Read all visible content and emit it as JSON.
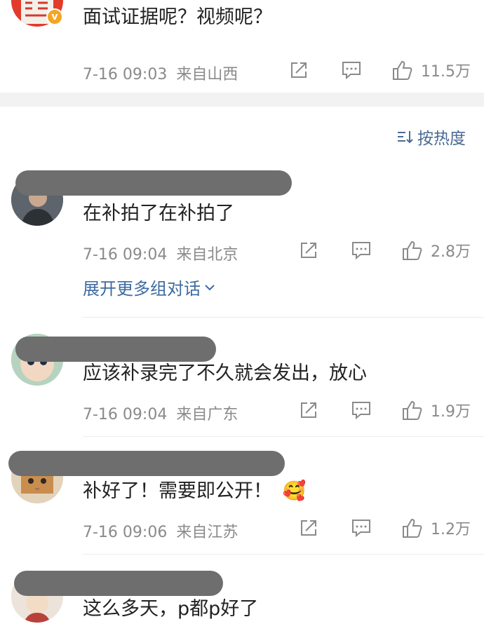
{
  "top_comment": {
    "text": "面试证据呢？视频呢？",
    "time": "7-16 09:03",
    "location": "来自山西",
    "likes": "11.5万",
    "avatar_icon": "seal-avatar-icon",
    "badge": "v"
  },
  "sort": {
    "label": "按热度",
    "icon": "sort-icon"
  },
  "expand_label": "展开更多组对话",
  "comments": [
    {
      "text": "在补拍了在补拍了",
      "time": "7-16 09:04",
      "location": "来自北京",
      "likes": "2.8万"
    },
    {
      "text": "应该补录完了不久就会发出，放心",
      "time": "7-16 09:04",
      "location": "来自广东",
      "likes": "1.9万"
    },
    {
      "text": "补好了！需要即公开！",
      "emoji": "🥰",
      "time": "7-16 09:06",
      "location": "来自江苏",
      "likes": "1.2万"
    },
    {
      "text": "这么多天，p都p好了"
    }
  ],
  "colors": {
    "accent": "#3e6aa0",
    "meta": "#8a8a8a",
    "divider": "#f2f2f2",
    "redaction": "#6e6e6e"
  }
}
